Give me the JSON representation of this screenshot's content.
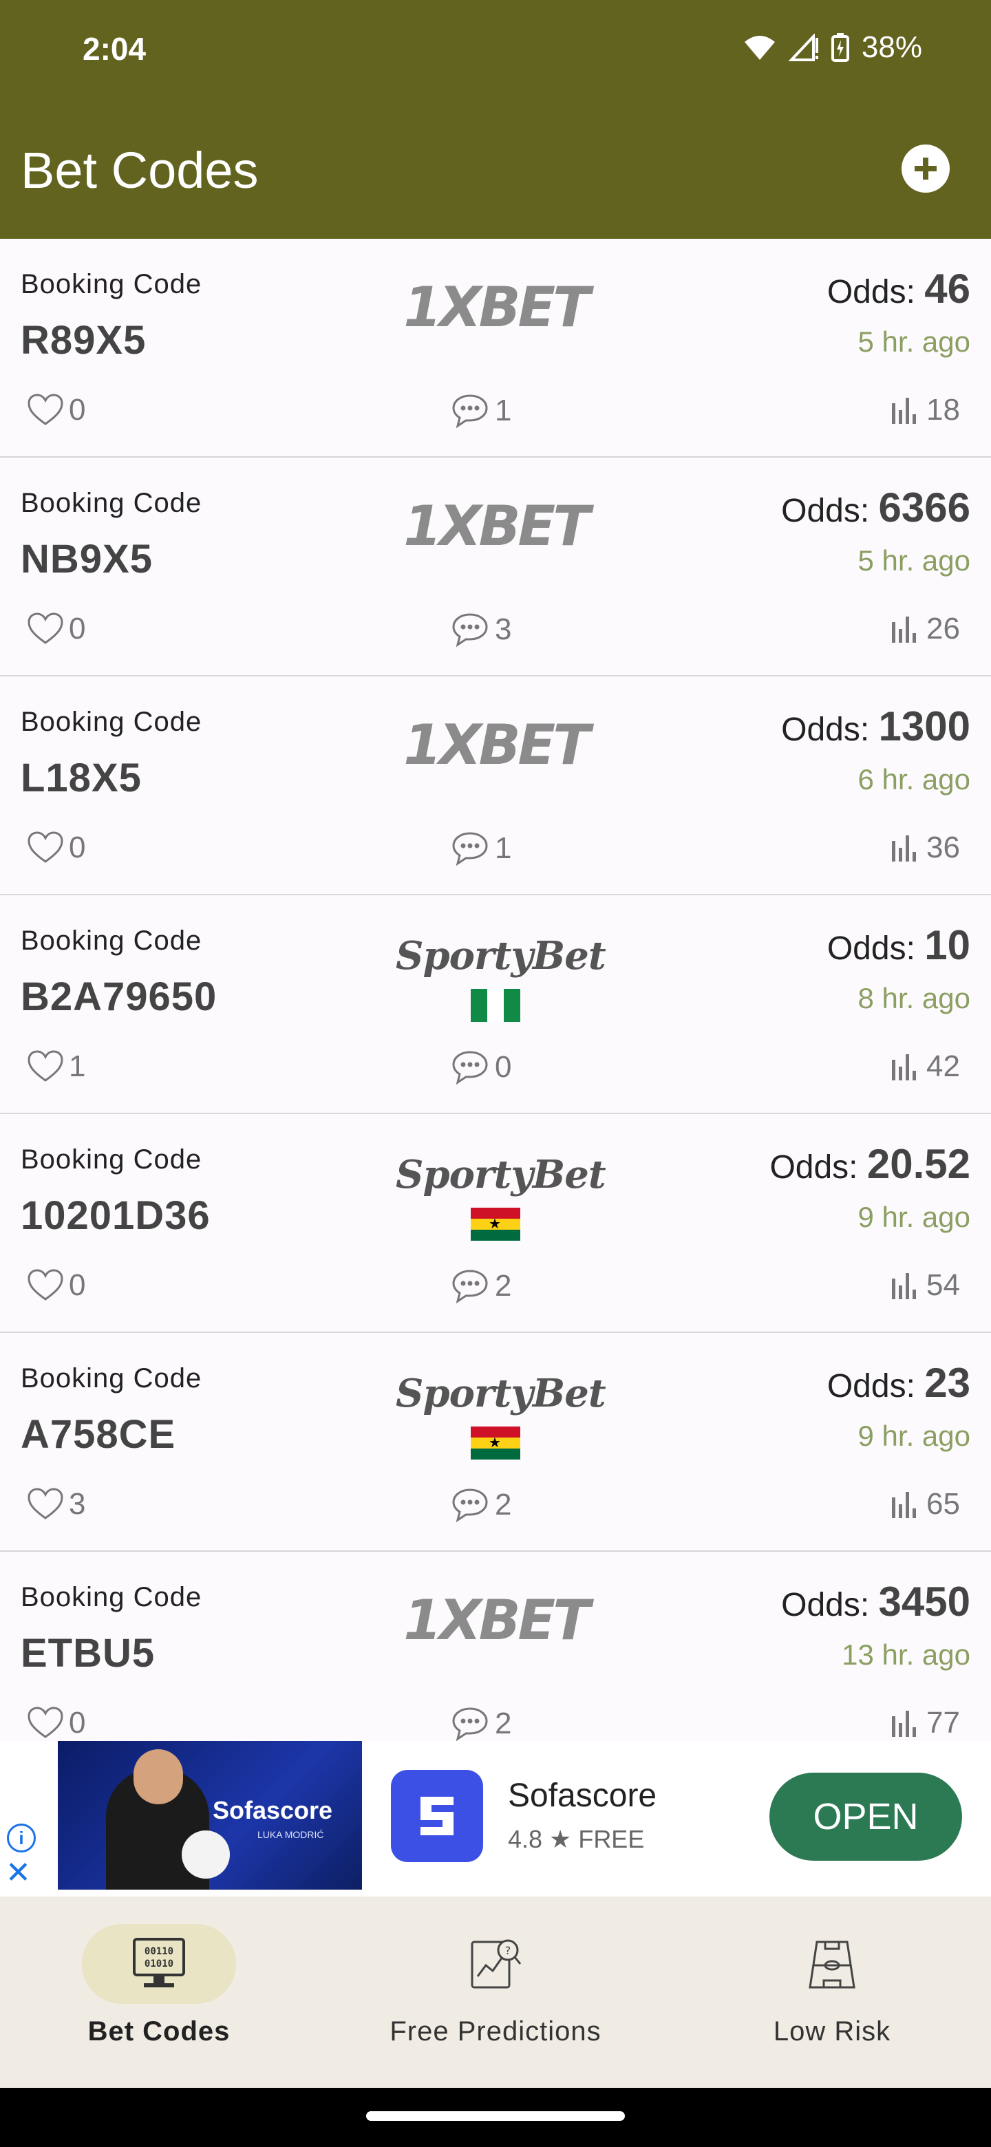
{
  "status_bar": {
    "time": "2:04",
    "battery": "38%"
  },
  "appbar": {
    "title": "Bet Codes",
    "add_icon": "add-circle-icon"
  },
  "cards": [
    {
      "label": "Booking Code",
      "code": "R89X5",
      "odds_label": "Odds:",
      "odds": "46",
      "ago": "5 hr. ago",
      "brand": "1XBET",
      "flag": "",
      "likes": "0",
      "comments": "1",
      "views": "18"
    },
    {
      "label": "Booking Code",
      "code": "NB9X5",
      "odds_label": "Odds:",
      "odds": "6366",
      "ago": "5 hr. ago",
      "brand": "1XBET",
      "flag": "",
      "likes": "0",
      "comments": "3",
      "views": "26"
    },
    {
      "label": "Booking Code",
      "code": "L18X5",
      "odds_label": "Odds:",
      "odds": "1300",
      "ago": "6 hr. ago",
      "brand": "1XBET",
      "flag": "",
      "likes": "0",
      "comments": "1",
      "views": "36"
    },
    {
      "label": "Booking Code",
      "code": "B2A79650",
      "odds_label": "Odds:",
      "odds": "10",
      "ago": "8 hr. ago",
      "brand": "SportyBet",
      "flag": "nigeria",
      "likes": "1",
      "comments": "0",
      "views": "42"
    },
    {
      "label": "Booking Code",
      "code": "10201D36",
      "odds_label": "Odds:",
      "odds": "20.52",
      "ago": "9 hr. ago",
      "brand": "SportyBet",
      "flag": "ghana",
      "likes": "0",
      "comments": "2",
      "views": "54"
    },
    {
      "label": "Booking Code",
      "code": "A758CE",
      "odds_label": "Odds:",
      "odds": "23",
      "ago": "9 hr. ago",
      "brand": "SportyBet",
      "flag": "ghana",
      "likes": "3",
      "comments": "2",
      "views": "65"
    },
    {
      "label": "Booking Code",
      "code": "ETBU5",
      "odds_label": "Odds:",
      "odds": "3450",
      "ago": "13 hr. ago",
      "brand": "1XBET",
      "flag": "",
      "likes": "0",
      "comments": "2",
      "views": "77"
    }
  ],
  "ad": {
    "image_brand": "Sofascore",
    "image_sub": "LUKA MODRIĆ",
    "app_name": "Sofascore",
    "rating": "4.8 ★  FREE",
    "cta": "OPEN"
  },
  "bottom_nav": [
    {
      "label": "Bet Codes",
      "icon": "computer-binary-icon",
      "active": true
    },
    {
      "label": "Free Predictions",
      "icon": "analytics-report-icon",
      "active": false
    },
    {
      "label": "Low Risk",
      "icon": "football-pitch-icon",
      "active": false
    }
  ],
  "colors": {
    "primary": "#636320",
    "accent_text": "#8c9f62",
    "ad_button": "#2c7a53",
    "nav_bg": "#f0ece4",
    "nav_active": "#e8e4c4"
  }
}
